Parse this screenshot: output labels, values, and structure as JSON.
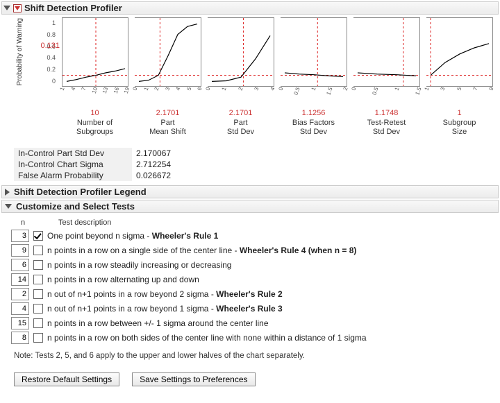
{
  "sections": {
    "main": "Shift Detection Profiler",
    "legend": "Shift Detection Profiler Legend",
    "custom": "Customize and Select Tests"
  },
  "yaxis_label": "Probability of\nWarning",
  "guide_value": "0.131",
  "yticks": [
    "1",
    "0.8",
    "0.6",
    "0.4",
    "0.2",
    "0"
  ],
  "chart_data": [
    {
      "type": "line",
      "ylim": [
        0,
        1
      ],
      "x": [
        1,
        4,
        7,
        10,
        13,
        16,
        19
      ],
      "xt": [
        "1",
        "4",
        "7",
        "10",
        "13",
        "16",
        "19"
      ],
      "y": [
        0.03,
        0.06,
        0.1,
        0.13,
        0.17,
        0.2,
        0.24
      ],
      "guide_x": 10,
      "guide_y": 0.131,
      "value": "10",
      "label": "Number of\nSubgroups"
    },
    {
      "type": "line",
      "ylim": [
        0,
        1
      ],
      "x": [
        0,
        1,
        2,
        3,
        4,
        5,
        6
      ],
      "xt": [
        "0",
        "1",
        "2",
        "3",
        "4",
        "5",
        "6"
      ],
      "y": [
        0.03,
        0.05,
        0.13,
        0.45,
        0.8,
        0.93,
        0.97
      ],
      "guide_x": 2.1701,
      "guide_y": 0.131,
      "value": "2.1701",
      "label": "Part\nMean Shift"
    },
    {
      "type": "line",
      "ylim": [
        0,
        1
      ],
      "x": [
        0,
        1,
        2,
        3,
        4
      ],
      "xt": [
        "0",
        "1",
        "2",
        "3",
        "4"
      ],
      "y": [
        0.03,
        0.04,
        0.1,
        0.4,
        0.78
      ],
      "guide_x": 2.1701,
      "guide_y": 0.131,
      "value": "2.1701",
      "label": "Part\nStd Dev"
    },
    {
      "type": "line",
      "ylim": [
        0,
        1
      ],
      "x": [
        0,
        0.5,
        1,
        1.5,
        2
      ],
      "xt": [
        "0",
        "0.5",
        "1",
        "1.5",
        "2"
      ],
      "y": [
        0.17,
        0.15,
        0.14,
        0.12,
        0.11
      ],
      "guide_x": 1.1256,
      "guide_y": 0.131,
      "value": "1.1256",
      "label": "Bias Factors\nStd Dev"
    },
    {
      "type": "line",
      "ylim": [
        0,
        1
      ],
      "x": [
        0,
        0.5,
        1,
        1.5
      ],
      "xt": [
        "0",
        "0.5",
        "1",
        "1.5"
      ],
      "y": [
        0.17,
        0.15,
        0.14,
        0.12
      ],
      "guide_x": 1.1748,
      "guide_y": 0.131,
      "value": "1.1748",
      "label": "Test-Retest\nStd Dev"
    },
    {
      "type": "line",
      "ylim": [
        0,
        1
      ],
      "x": [
        1,
        3,
        5,
        7,
        9
      ],
      "xt": [
        "1",
        "3",
        "5",
        "7",
        "9"
      ],
      "y": [
        0.13,
        0.34,
        0.48,
        0.58,
        0.65
      ],
      "guide_x": 1,
      "guide_y": 0.131,
      "value": "1",
      "label": "Subgroup\nSize"
    }
  ],
  "metrics": [
    {
      "k": "In-Control Part Std Dev",
      "v": "2.170067"
    },
    {
      "k": "In-Control Chart Sigma",
      "v": "2.712254"
    },
    {
      "k": "False Alarm Probability",
      "v": "0.026672"
    }
  ],
  "tests_header": {
    "n": "n",
    "desc": "Test description"
  },
  "tests": [
    {
      "n": "3",
      "checked": true,
      "desc": "One point beyond n sigma",
      "rule": "Wheeler's Rule 1"
    },
    {
      "n": "9",
      "checked": false,
      "desc": "n points in a row on a single side of the center line",
      "rule": "Wheeler's Rule 4 (when n = 8)"
    },
    {
      "n": "6",
      "checked": false,
      "desc": "n points in a row steadily increasing or decreasing",
      "rule": ""
    },
    {
      "n": "14",
      "checked": false,
      "desc": "n points in a row alternating up and down",
      "rule": ""
    },
    {
      "n": "2",
      "checked": false,
      "desc": "n out of n+1 points in a row beyond 2 sigma",
      "rule": "Wheeler's Rule 2"
    },
    {
      "n": "4",
      "checked": false,
      "desc": "n out of n+1 points in a row beyond 1 sigma",
      "rule": "Wheeler's Rule 3"
    },
    {
      "n": "15",
      "checked": false,
      "desc": "n points in a row between +/- 1 sigma around the center line",
      "rule": ""
    },
    {
      "n": "8",
      "checked": false,
      "desc": "n points in a row on both sides of the center line with none within a distance of 1 sigma",
      "rule": ""
    }
  ],
  "note": "Note: Tests 2, 5, and 6 apply to the upper and lower halves of the chart separately.",
  "buttons": {
    "restore": "Restore Default Settings",
    "save": "Save Settings to Preferences"
  }
}
